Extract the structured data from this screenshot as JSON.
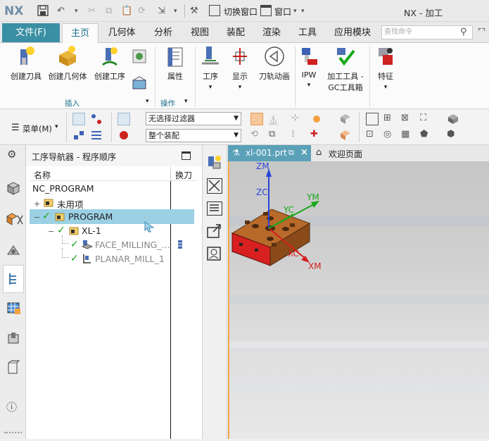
{
  "titlebar": {
    "logo": "NX",
    "switch_window": "切换窗口",
    "window_menu": "窗口",
    "title": "NX - 加工"
  },
  "ribbon_tabs": {
    "file": "文件(F)",
    "tabs": [
      "主页",
      "几何体",
      "分析",
      "视图",
      "装配",
      "渲染",
      "工具",
      "应用模块"
    ],
    "active": "主页",
    "search_placeholder": "查找命令"
  },
  "ribbon": {
    "buttons": [
      {
        "label": "创建刀具",
        "icon": "create-tool-icon"
      },
      {
        "label": "创建几何体",
        "icon": "create-geometry-icon"
      },
      {
        "label": "创建工序",
        "icon": "create-operation-icon"
      },
      {
        "label": "属性",
        "icon": "properties-icon"
      },
      {
        "label": "工序",
        "icon": "operation-icon"
      },
      {
        "label": "显示",
        "icon": "display-icon"
      },
      {
        "label": "刀轨动画",
        "icon": "toolpath-animation-icon"
      },
      {
        "label": "IPW",
        "icon": "ipw-icon"
      },
      {
        "label": "加工工具 -",
        "label2": "GC工具箱",
        "icon": "gc-toolbox-icon"
      },
      {
        "label": "特征",
        "icon": "feature-icon"
      }
    ],
    "groups": {
      "insert": "插入",
      "operations": "操作"
    }
  },
  "toolbar2": {
    "menu": "菜单(M)",
    "filter": "无选择过滤器",
    "assembly": "整个装配"
  },
  "navigator": {
    "title": "工序导航器 - 程序顺序",
    "col_name": "名称",
    "col_toolchange": "换刀",
    "tree": {
      "root": "NC_PROGRAM",
      "unused": "未用项",
      "program": "PROGRAM",
      "xl1": "XL-1",
      "op1": "FACE_MILLING_...",
      "op2": "PLANAR_MILL_1"
    }
  },
  "doc_tabs": {
    "active": "xl-001.prt",
    "welcome": "欢迎页面"
  },
  "viewport": {
    "axes": [
      "ZM",
      "ZC",
      "YM",
      "YC",
      "XC",
      "XM"
    ]
  },
  "colors": {
    "accent": "#3a8fa4",
    "selection": "#9cd0e4",
    "part_body": "#b5651d",
    "part_face_red": "#d31f1f",
    "axis_z": "#2a45d6",
    "axis_y": "#18a818",
    "axis_x": "#d61c1c"
  }
}
